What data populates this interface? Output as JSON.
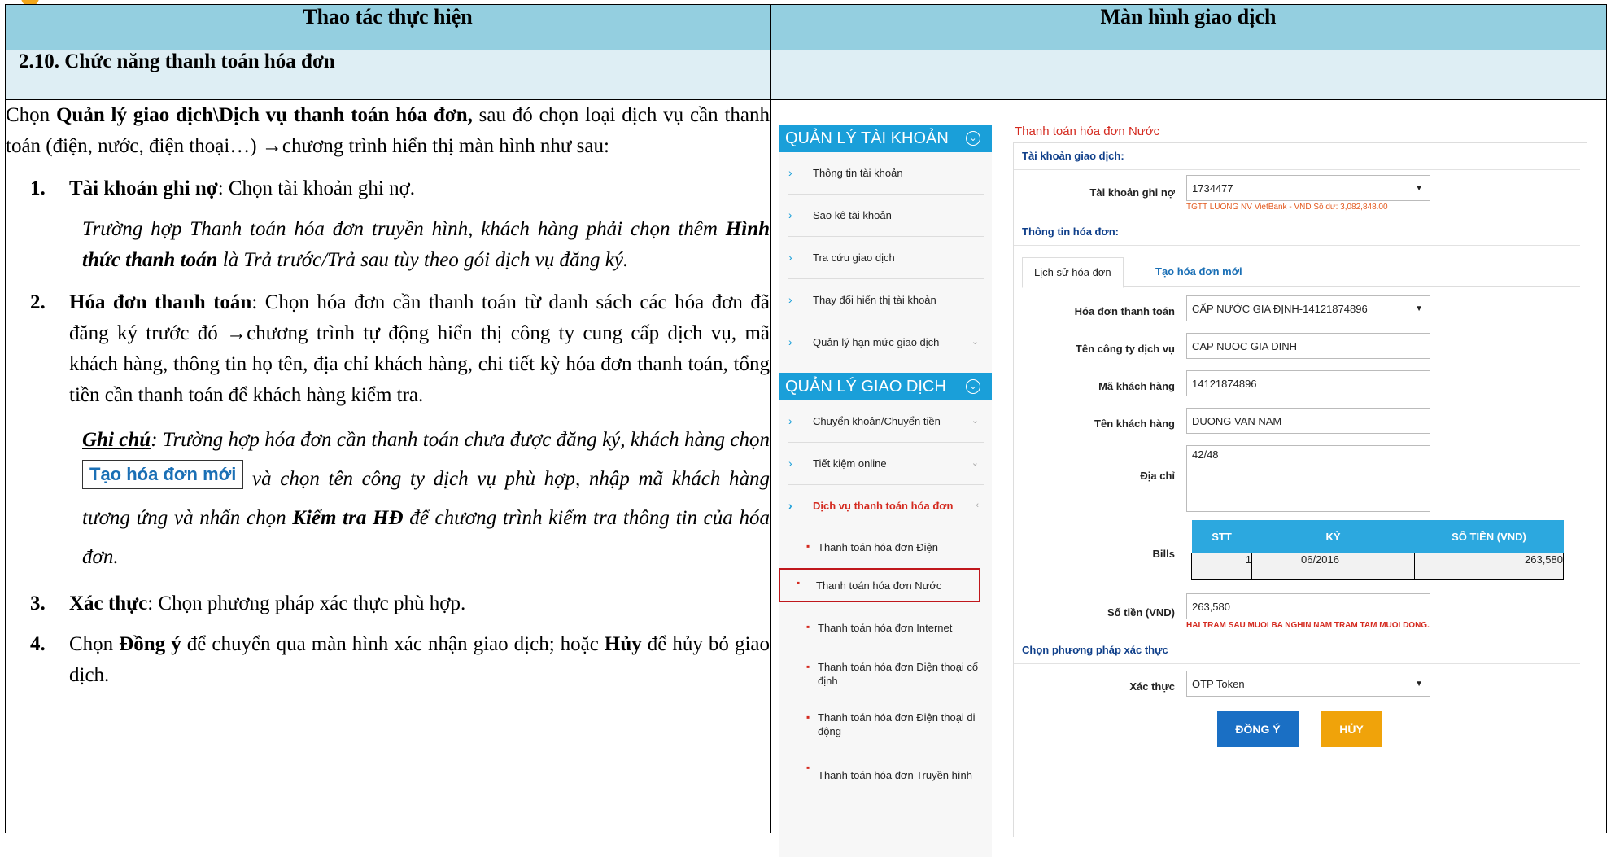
{
  "table": {
    "col_left_header": "Thao tác thực hiện",
    "col_right_header": "Màn hình giao dịch",
    "section_title": "2.10.  Chức năng thanh toán hóa đơn"
  },
  "instructions": {
    "intro_1": "Chọn ",
    "intro_bold": "Quản lý giao dịch\\Dịch vụ thanh toán hóa đơn,",
    "intro_2": " sau đó chọn loại dịch vụ cần thanh toán (điện, nước, điện thoại…) →chương trình hiển thị màn hình như sau:",
    "steps": [
      {
        "num": "1.",
        "bold": "Tài khoản ghi nợ",
        "text": ": Chọn tài khoản ghi nợ."
      },
      {
        "num": "2.",
        "bold": "Hóa đơn thanh toán",
        "text": ": Chọn hóa đơn cần thanh toán từ danh sách các hóa đơn đã đăng ký trước đó →chương trình tự động hiển thị công ty cung cấp dịch vụ, mã khách hàng, thông tin họ tên, địa chỉ khách hàng, chi tiết kỳ hóa đơn thanh toán, tổng tiền cần thanh toán để khách hàng kiểm tra."
      },
      {
        "num": "3.",
        "bold": "Xác thực",
        "text": ": Chọn phương pháp xác thực phù hợp."
      },
      {
        "num": "4.",
        "text_a": "Chọn ",
        "bold_a": "Đồng ý",
        "text_b": " để chuyển qua màn hình xác nhận giao dịch; hoặc ",
        "bold_b": "Hủy",
        "text_c": " để hủy bỏ giao dịch."
      }
    ],
    "tv_note_1": "Trường hợp Thanh toán hóa đơn truyền hình, khách hàng phải chọn thêm ",
    "tv_note_bold": "Hình thức thanh toán",
    "tv_note_2": " là Trả trước/Trả sau tùy theo gói dịch vụ đăng ký.",
    "ghichu_label": "Ghi chú",
    "ghichu_1": ": Trường hợp hóa đơn cần thanh toán chưa được đăng ký, khách hàng chọn ",
    "ghichu_button": "Tạo hóa đơn mới",
    "ghichu_2": " và chọn tên công ty dịch vụ phù hợp, nhập mã khách hàng tương ứng và nhấn chọn ",
    "ghichu_bold": "Kiểm tra HĐ",
    "ghichu_3": " để chương trình kiểm tra thông tin của hóa đơn."
  },
  "sidebar": {
    "group1_title": "QUẢN LÝ TÀI KHOẢN",
    "group1_items": [
      "Thông tin tài khoản",
      "Sao kê tài khoản",
      "Tra cứu giao dịch",
      "Thay đổi hiển thị tài khoản",
      "Quản lý hạn mức giao dịch"
    ],
    "group2_title": "QUẢN LÝ GIAO DỊCH",
    "group2_items": [
      "Chuyển khoản/Chuyển tiền",
      "Tiết kiệm online",
      "Dịch vụ thanh toán hóa đơn"
    ],
    "sub_items": [
      "Thanh toán hóa đơn Điện",
      "Thanh toán hóa đơn Nước",
      "Thanh toán hóa đơn Internet",
      "Thanh toán hóa đơn Điện thoại cố định",
      "Thanh toán hóa đơn Điện thoại di động",
      "Thanh toán hóa đơn Truyền hình"
    ]
  },
  "form": {
    "page_title": "Thanh toán hóa đơn Nước",
    "account_section": "Tài khoản giao dịch:",
    "debit_label": "Tài khoản ghi nợ",
    "debit_value": "1734477",
    "debit_note": "TGTT LUONG NV VietBank - VND   Số dư: 3,082,848.00",
    "bill_section": "Thông tin hóa đơn:",
    "tab_history": "Lịch sử hóa đơn",
    "tab_new": "Tạo hóa đơn mới",
    "bill_label": "Hóa đơn thanh toán",
    "bill_value": "CẤP NƯỚC GIA ĐỊNH-14121874896",
    "company_label": "Tên công ty dịch vụ",
    "company_value": "CAP NUOC GIA DINH",
    "customer_code_label": "Mã khách hàng",
    "customer_code_value": "14121874896",
    "customer_name_label": "Tên khách hàng",
    "customer_name_value": "DUONG VAN NAM",
    "address_label": "Địa chỉ",
    "address_value": "42/48",
    "bills_label": "Bills",
    "bills_headers": [
      "STT",
      "KỲ",
      "SỐ TIỀN (VND)"
    ],
    "bills_row": [
      "1",
      "06/2016",
      "263,580"
    ],
    "amount_label": "Số tiền (VND)",
    "amount_value": "263,580",
    "amount_words": "HAI TRAM SAU MUOI BA NGHIN NAM TRAM TAM MUOI DONG.",
    "auth_section": "Chọn phương pháp xác thực",
    "auth_label": "Xác thực",
    "auth_value": "OTP Token",
    "agree_button": "ĐỒNG Ý",
    "cancel_button": "HỦY"
  },
  "colors": {
    "header_bg": "#94cfe0",
    "accent_blue": "#1a9fd9",
    "highlight_red": "#c0171c",
    "agree": "#1a6fc4",
    "cancel": "#f0a30a"
  }
}
